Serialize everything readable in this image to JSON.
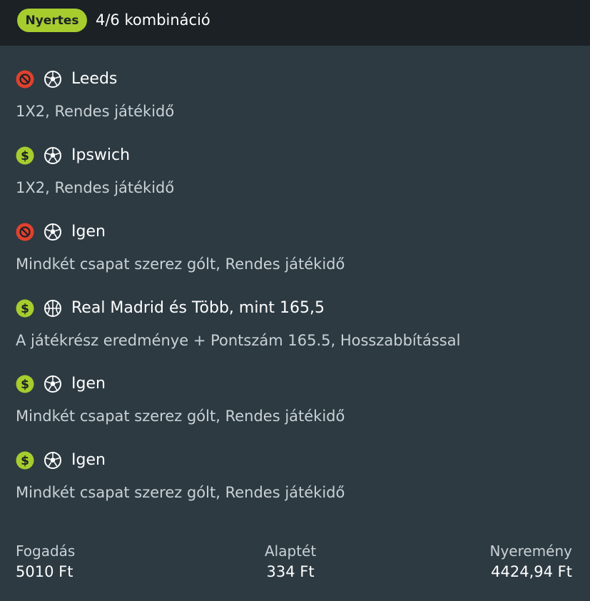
{
  "header": {
    "status_badge": "Nyertes",
    "combination": "4/6 kombináció"
  },
  "selections": [
    {
      "status": "lost",
      "sport": "soccer",
      "title": "Leeds",
      "market": "1X2, Rendes játékidő"
    },
    {
      "status": "won",
      "sport": "soccer",
      "title": "Ipswich",
      "market": "1X2, Rendes játékidő"
    },
    {
      "status": "lost",
      "sport": "soccer",
      "title": "Igen",
      "market": "Mindkét csapat szerez gólt, Rendes játékidő"
    },
    {
      "status": "won",
      "sport": "basketball",
      "title": "Real Madrid és Több, mint 165,5",
      "market": "A játékrész eredménye + Pontszám 165.5, Hosszabbítással"
    },
    {
      "status": "won",
      "sport": "soccer",
      "title": "Igen",
      "market": "Mindkét csapat szerez gólt, Rendes játékidő"
    },
    {
      "status": "won",
      "sport": "soccer",
      "title": "Igen",
      "market": "Mindkét csapat szerez gólt, Rendes játékidő"
    }
  ],
  "footer": {
    "stake_label": "Fogadás",
    "stake_value": "5010 Ft",
    "base_stake_label": "Alaptét",
    "base_stake_value": "334 Ft",
    "winnings_label": "Nyeremény",
    "winnings_value": "4424,94 Ft"
  },
  "colors": {
    "background": "#2d3a42",
    "header_background": "#1b2125",
    "won": "#a6cc2e",
    "lost": "#e0412f",
    "muted_text": "#c9d1d6"
  },
  "icons": {
    "won": "dollar-icon",
    "lost": "no-symbol-icon",
    "soccer": "soccer-ball-icon",
    "basketball": "basketball-icon"
  }
}
